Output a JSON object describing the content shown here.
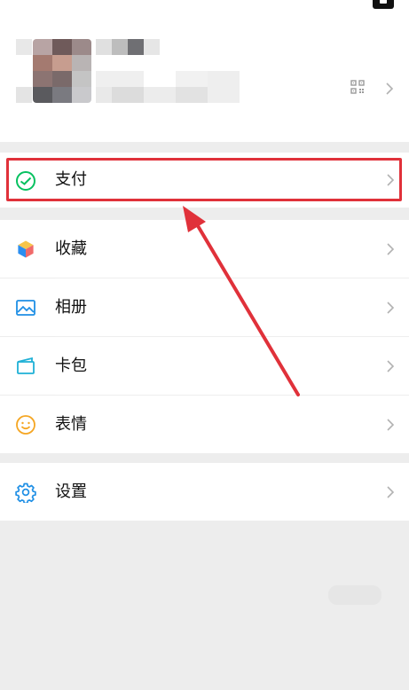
{
  "menu": {
    "pay": "支付",
    "favorites": "收藏",
    "album": "相册",
    "cards": "卡包",
    "stickers": "表情",
    "settings": "设置"
  },
  "icons": {
    "pay": "pay-icon",
    "favorites": "cube-icon",
    "album": "picture-icon",
    "cards": "wallet-icon",
    "stickers": "smile-icon",
    "settings": "gear-icon",
    "qr": "qr-code-icon",
    "chevron": "chevron-right-icon"
  },
  "colors": {
    "highlight": "#e0313a",
    "pay_green": "#07c160",
    "blue": "#1f8fe5",
    "sticker_orange": "#f5a623"
  }
}
